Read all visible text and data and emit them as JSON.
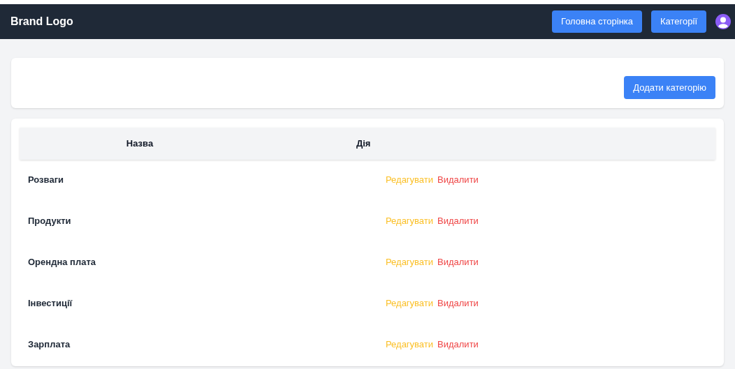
{
  "navbar": {
    "brand": "Brand Logo",
    "links": [
      "Головна сторінка",
      "Категорії"
    ]
  },
  "toolbar": {
    "add_button": "Додати категорію"
  },
  "table": {
    "columns": [
      "Назва",
      "Дія"
    ],
    "rows": [
      {
        "name": "Розваги",
        "edit": "Редагувати",
        "delete": "Видалити"
      },
      {
        "name": "Продукти",
        "edit": "Редагувати",
        "delete": "Видалити"
      },
      {
        "name": "Орендна плата",
        "edit": "Редагувати",
        "delete": "Видалити"
      },
      {
        "name": "Інвестиції",
        "edit": "Редагувати",
        "delete": "Видалити"
      },
      {
        "name": "Зарплата",
        "edit": "Редагувати",
        "delete": "Видалити"
      }
    ]
  }
}
